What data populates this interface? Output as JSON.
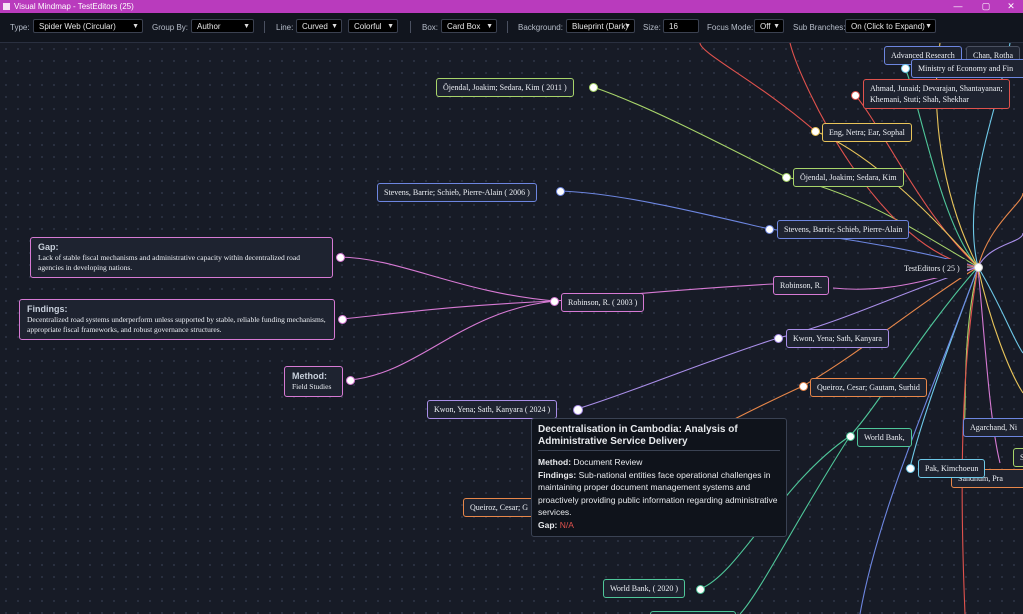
{
  "window": {
    "title": "Visual Mindmap - TestEditors (25)",
    "controls": {
      "minimize": "—",
      "maximize": "▢",
      "close": "✕"
    }
  },
  "toolbar": {
    "type_label": "Type:",
    "type_value": "Spider Web (Circular)",
    "group_label": "Group By:",
    "group_value": "Author",
    "line_label": "Line:",
    "line_style_value": "Curved",
    "line_color_value": "Colorful",
    "box_label": "Box:",
    "box_value": "Card Box",
    "background_label": "Background:",
    "background_value": "Blueprint (Dark)",
    "size_label": "Size:",
    "size_value": "16",
    "focus_label": "Focus Mode:",
    "focus_value": "Off",
    "sub_label": "Sub Branches:",
    "sub_value": "On (Click to Expand)"
  },
  "colors": {
    "pink": "#d77ad4",
    "blue": "#6d86e0",
    "green": "#a8d46a",
    "orange": "#e8874a",
    "yellow": "#e8c45a",
    "red": "#e0524d",
    "teal": "#4fc79a",
    "cyan": "#6ec9e8",
    "purple": "#a98ee8"
  },
  "center": {
    "label": "TestEditors ( 25 )"
  },
  "nodes": [
    {
      "label": "Advanced Research"
    },
    {
      "label": "Chan, Rotha"
    },
    {
      "label": "Ministry of Economy and Fin"
    },
    {
      "label": "Ahmad, Junaid; Devarajan, Shantayanan;"
    },
    {
      "label": "Khemani, Stuti; Shah, Shekhar"
    },
    {
      "label": "Öjendal, Joakim; Sedara, Kim ( 2011 )"
    },
    {
      "label": "Eng, Netra; Ear, Sophal"
    },
    {
      "label": "Öjendal, Joakim; Sedara, Kim"
    },
    {
      "label": "Stevens, Barrie; Schieb, Pierre-Alain ( 2006 )"
    },
    {
      "label": "Stevens, Barrie; Schieb, Pierre-Alain"
    },
    {
      "label": "Robinson, R."
    },
    {
      "label": "Robinson, R. ( 2003 )"
    },
    {
      "label": "Kwon, Yena; Sath, Kanyara"
    },
    {
      "label": "Queiroz, Cesar; Gautam, Surhid"
    },
    {
      "label": "Kwon, Yena; Sath, Kanyara ( 2024 )"
    },
    {
      "label": "World Bank,"
    },
    {
      "label": "Agarchand, Ni"
    },
    {
      "label": "Pak, Kimchoeun"
    },
    {
      "label": "Sandhum, Pra"
    },
    {
      "label": "Queiroz, Cesar; G"
    },
    {
      "label": "World Bank, ( 2020 )"
    },
    {
      "label": "S"
    }
  ],
  "details": {
    "gap": {
      "heading": "Gap:",
      "text": "Lack of stable fiscal mechanisms and administrative capacity within decentralized road agencies in developing nations."
    },
    "findings": {
      "heading": "Findings:",
      "text": "Decentralized road systems underperform unless supported by stable, reliable funding mechanisms, appropriate fiscal frameworks, and robust governance structures."
    },
    "method": {
      "heading": "Method:",
      "text": "Field Studies"
    }
  },
  "tooltip": {
    "title": "Decentralisation in Cambodia: Analysis of Administrative Service Delivery",
    "method_label": "Method:",
    "method_value": "Document Review",
    "findings_label": "Findings:",
    "findings_value": "Sub-national entities face operational challenges in maintaining proper document management systems and proactively providing public information regarding administrative services.",
    "gap_label": "Gap:",
    "gap_value": "N/A"
  }
}
